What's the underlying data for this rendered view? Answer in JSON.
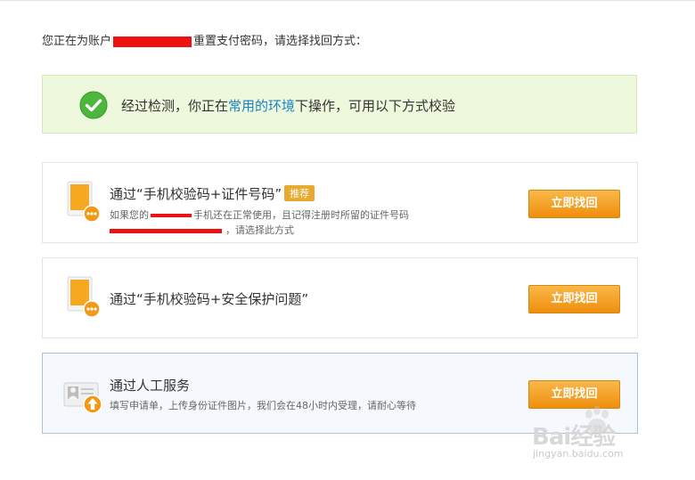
{
  "intro": {
    "before": "您正在为账户",
    "after": "重置支付密码，请选择找回方式："
  },
  "notice": {
    "before": "经过检测，你正在",
    "link": "常用的环境",
    "after": "下操作，可用以下方式校验"
  },
  "options": [
    {
      "title": "通过“手机校验码+证件号码”",
      "badge": "推荐",
      "desc1_before": "如果您的",
      "desc1_after": "手机还在正常使用，且记得注册时所留的证件号码",
      "desc2_after": "，请选择此方式",
      "button": "立即找回"
    },
    {
      "title": "通过“手机校验码+安全保护问题”",
      "button": "立即找回"
    },
    {
      "title": "通过人工服务",
      "desc": "填写申请单，上传身份证件图片，我们会在48小时内受理，请耐心等待",
      "button": "立即找回"
    }
  ],
  "watermark": {
    "brand": "Bai经验",
    "url": "jingyan.baidu.com"
  },
  "colors": {
    "button": "#f3a12a",
    "link": "#1a83c8",
    "notice_bg": "#eef8dc",
    "check": "#4db63c",
    "redaction": "#ee1111"
  },
  "icons": {
    "check": "check-circle-icon",
    "phone": "phone-icon",
    "manual_service": "id-card-upload-icon"
  }
}
